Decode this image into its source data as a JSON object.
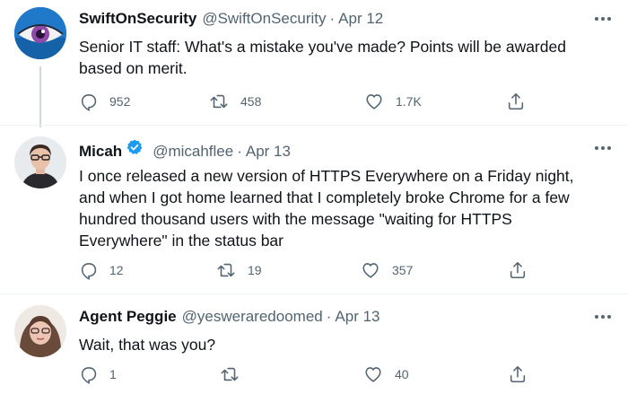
{
  "tweets": [
    {
      "display_name": "SwiftOnSecurity",
      "handle": "@SwiftOnSecurity",
      "separator": "·",
      "date": "Apr 12",
      "text": "Senior IT staff: What's a mistake you've made? Points will be awarded\nbased on merit.",
      "replies": "952",
      "retweets": "458",
      "likes": "1.7K",
      "verified": false
    },
    {
      "display_name": "Micah",
      "handle": "@micahflee",
      "separator": "·",
      "date": "Apr 13",
      "text": "I once released a new version of HTTPS Everywhere on a Friday night,\nand when I got home learned that I completely broke Chrome for a few\nhundred thousand users with the message \"waiting for HTTPS\nEverywhere\" in the status bar",
      "replies": "12",
      "retweets": "19",
      "likes": "357",
      "verified": true
    },
    {
      "display_name": "Agent Peggie",
      "handle": "@yesweraredoomed",
      "separator": "·",
      "date": "Apr 13",
      "text": "Wait, that was you?",
      "replies": "1",
      "retweets": "",
      "likes": "40",
      "verified": false
    }
  ],
  "icons": [
    "reply-icon",
    "retweet-icon",
    "like-icon",
    "share-icon",
    "more-icon",
    "verified-badge-icon"
  ],
  "colors": {
    "secondary_text": "#536471",
    "verified_blue": "#1d9bf0",
    "thread_line": "#cfd9de"
  }
}
